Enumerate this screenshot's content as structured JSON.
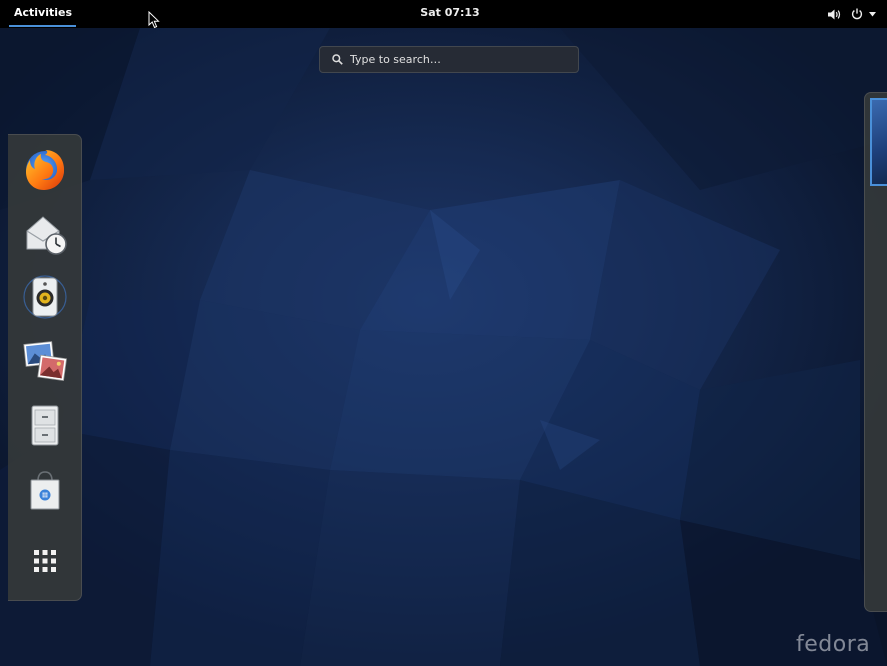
{
  "top_bar": {
    "activities_label": "Activities",
    "clock": "Sat 07:13",
    "status_icons": [
      "volume-icon",
      "power-icon",
      "dropdown-arrow-icon"
    ]
  },
  "search": {
    "placeholder": "Type to search…",
    "value": ""
  },
  "dash": {
    "items": [
      {
        "name": "firefox",
        "icon": "firefox-icon"
      },
      {
        "name": "evolution",
        "icon": "mail-clock-icon"
      },
      {
        "name": "rhythmbox",
        "icon": "speaker-icon"
      },
      {
        "name": "shotwell",
        "icon": "photos-icon"
      },
      {
        "name": "files",
        "icon": "file-cabinet-icon"
      },
      {
        "name": "software",
        "icon": "software-bag-icon"
      },
      {
        "name": "show-applications",
        "icon": "app-grid-icon"
      }
    ]
  },
  "workspaces": {
    "count": 1,
    "active_index": 0
  },
  "branding": {
    "logo": "fedora"
  },
  "colors": {
    "top_bar": "#000000",
    "accent": "#4a90d9",
    "wallpaper": "#162a52"
  }
}
